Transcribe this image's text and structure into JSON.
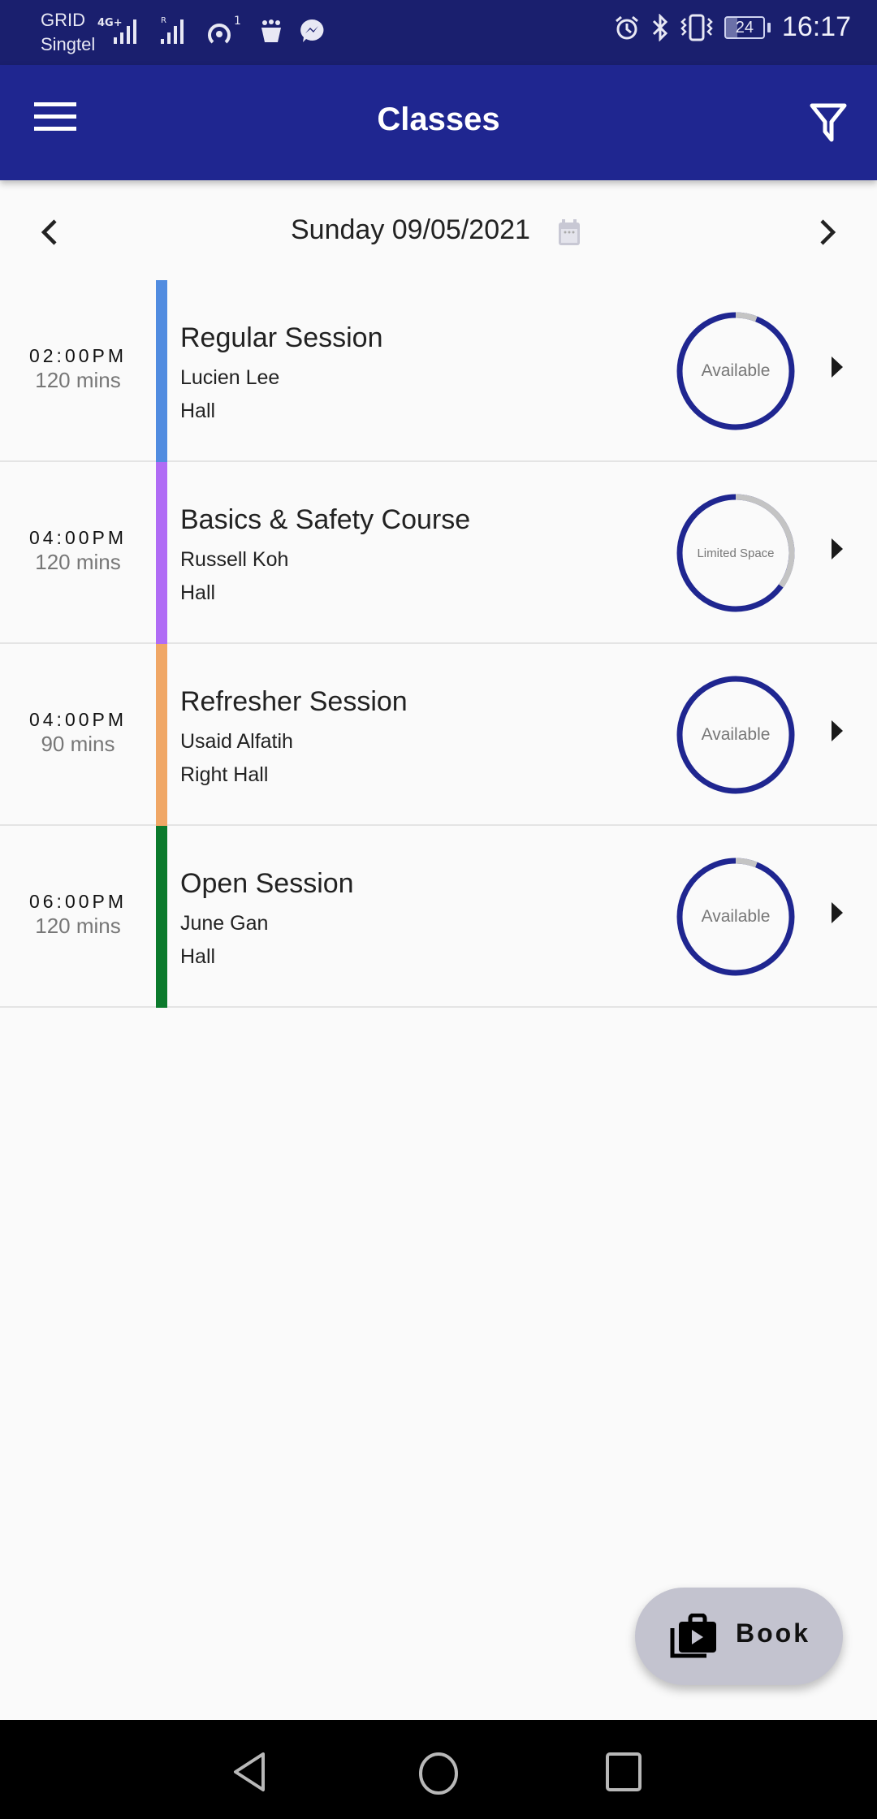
{
  "status_bar": {
    "carrier_line1": "GRID",
    "carrier_line2": "Singtel",
    "network": "4G+",
    "notification_count": "1",
    "battery": "24",
    "time": "16:17"
  },
  "app_bar": {
    "title": "Classes",
    "menu_icon": "hamburger-menu-icon",
    "filter_icon": "filter-funnel-icon"
  },
  "date_nav": {
    "date": "Sunday 09/05/2021",
    "prev_icon": "chevron-left-icon",
    "next_icon": "chevron-right-icon",
    "calendar_icon": "calendar-icon"
  },
  "colors": {
    "primary": "#1f2690",
    "status_bar": "#1a1f6e",
    "ring_available": "#1f2690",
    "ring_taken": "#c4c4c4"
  },
  "classes": [
    {
      "time": "02:00PM",
      "duration": "120 mins",
      "name": "Regular Session",
      "instructor": "Lucien Lee",
      "venue": "Hall",
      "color": "#518ce0",
      "status": "Available",
      "available_fraction": 0.94
    },
    {
      "time": "04:00PM",
      "duration": "120 mins",
      "name": "Basics & Safety Course",
      "instructor": "Russell Koh",
      "venue": "Hall",
      "color": "#b06cf5",
      "status": "Limited Space",
      "available_fraction": 0.65
    },
    {
      "time": "04:00PM",
      "duration": "90 mins",
      "name": "Refresher Session",
      "instructor": "Usaid Alfatih",
      "venue": "Right Hall",
      "color": "#f0a766",
      "status": "Available",
      "available_fraction": 1.0
    },
    {
      "time": "06:00PM",
      "duration": "120 mins",
      "name": "Open Session",
      "instructor": "June Gan",
      "venue": "Hall",
      "color": "#0b7a2c",
      "status": "Available",
      "available_fraction": 0.94
    }
  ],
  "fab": {
    "label": "Book",
    "icon": "book-bag-icon"
  },
  "system_nav": {
    "back": "back-icon",
    "home": "home-icon",
    "recents": "recents-icon"
  }
}
